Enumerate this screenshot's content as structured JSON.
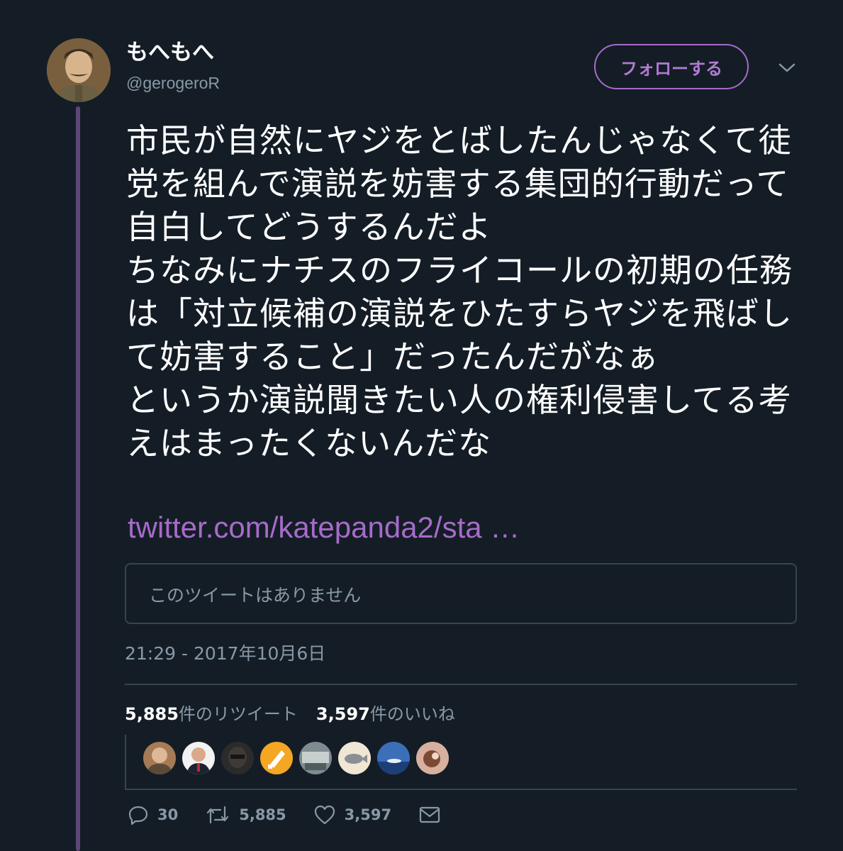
{
  "author": {
    "display_name": "もへもへ",
    "handle": "@gerogeroR",
    "avatar_icon": "user-avatar"
  },
  "follow_button": {
    "label": "フォローする"
  },
  "tweet": {
    "text": "市民が自然にヤジをとばしたんじゃなくて徒党を組んで演説を妨害する集団的行動だって自白してどうするんだよ\nちなみにナチスのフライコールの初期の任務は「対立候補の演説をひたすらヤジを飛ばして妨害すること」だったんだがなぁ\nというか演説聞きたい人の権利侵害してる考えはまったくないんだな",
    "link": "twitter.com/katepanda2/sta …"
  },
  "quoted_tweet": {
    "unavailable_text": "このツイートはありません"
  },
  "timestamp": "21:29 - 2017年10月6日",
  "stats": {
    "retweets_count": "5,885",
    "retweets_label": "件のリツイート",
    "likes_count": "3,597",
    "likes_label": "件のいいね"
  },
  "likers": [
    "liker-avatar-1",
    "liker-avatar-2",
    "liker-avatar-3",
    "liker-avatar-4",
    "liker-avatar-5",
    "liker-avatar-6",
    "liker-avatar-7",
    "liker-avatar-8"
  ],
  "actions": {
    "reply_count": "30",
    "retweet_count": "5,885",
    "like_count": "3,597"
  },
  "colors": {
    "background": "#141d26",
    "accent": "#a76bc9",
    "muted": "#8899a6",
    "border": "#38444d",
    "thread_line": "#5f4677"
  }
}
